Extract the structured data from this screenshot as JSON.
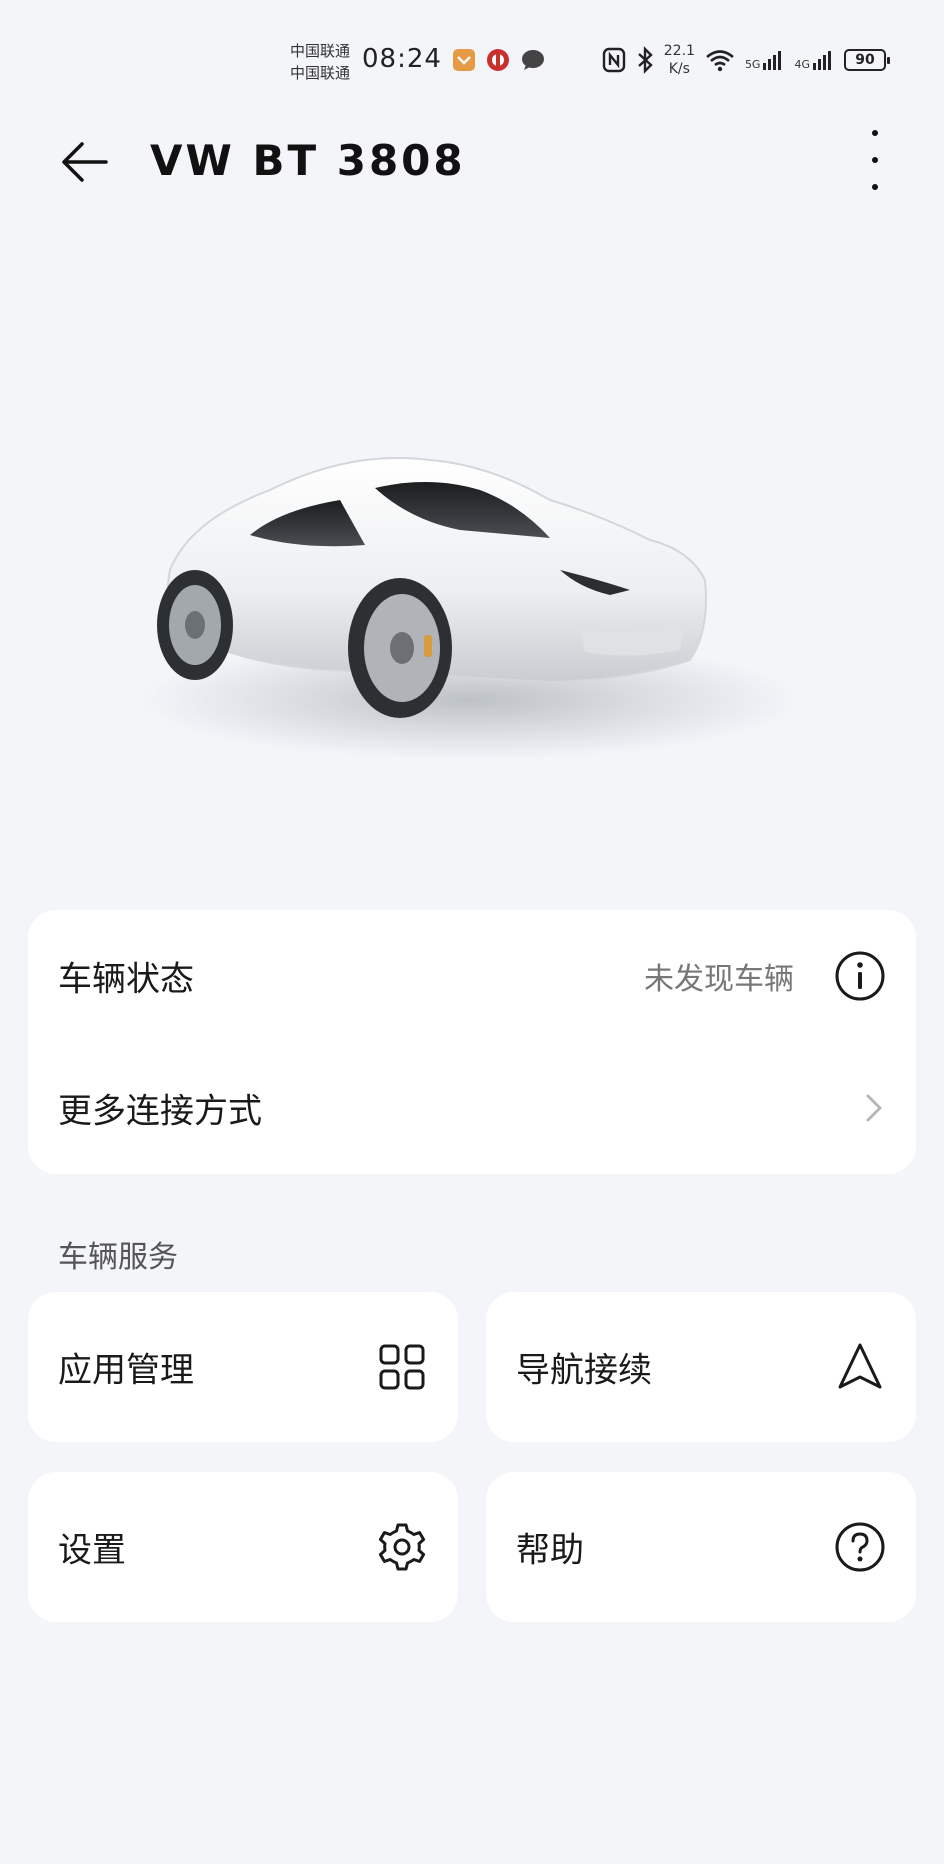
{
  "status_bar": {
    "carrier1": "中国联通",
    "carrier2": "中国联通",
    "time": "08:24",
    "speed_value": "22.1",
    "speed_unit": "K/s",
    "net1": "5G",
    "net2": "4G",
    "battery": "90"
  },
  "header": {
    "title": "VW BT 3808"
  },
  "vehicle": {
    "status_label": "车辆状态",
    "status_value": "未发现车辆",
    "more_connect_label": "更多连接方式"
  },
  "services": {
    "section_title": "车辆服务",
    "items": [
      {
        "label": "应用管理",
        "icon": "grid-icon"
      },
      {
        "label": "导航接续",
        "icon": "navigation-arrow-icon"
      },
      {
        "label": "设置",
        "icon": "gear-icon"
      },
      {
        "label": "帮助",
        "icon": "help-circle-icon"
      }
    ]
  },
  "colors": {
    "background": "#f3f5f9",
    "card": "#ffffff",
    "text": "#1a1a1a",
    "secondary": "#777777"
  }
}
